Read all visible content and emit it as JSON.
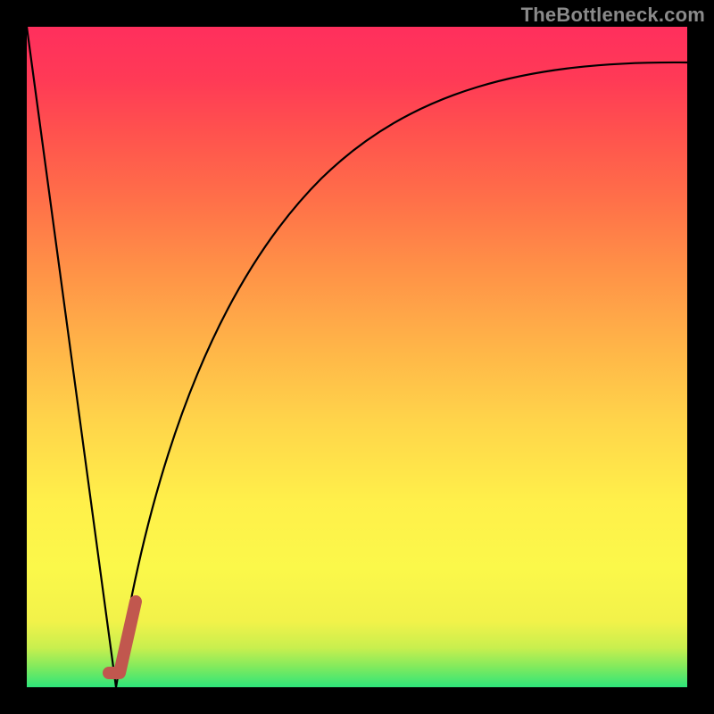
{
  "brand": {
    "label": "TheBottleneck.com"
  },
  "chart_data": {
    "type": "line",
    "title": "",
    "xlabel": "",
    "ylabel": "",
    "xlim": [
      0,
      100
    ],
    "ylim": [
      0,
      100
    ],
    "grid": false,
    "legend": false,
    "background_gradient": {
      "direction": "vertical",
      "stops": [
        {
          "pos": 0.0,
          "color": "#2ee57a"
        },
        {
          "pos": 0.1,
          "color": "#f2f24a"
        },
        {
          "pos": 0.5,
          "color": "#ffb04a"
        },
        {
          "pos": 1.0,
          "color": "#ff2f5d"
        }
      ]
    },
    "series": [
      {
        "name": "notch-left",
        "color": "#000000",
        "width": 2,
        "x": [
          0,
          2,
          4,
          6,
          8,
          10,
          12,
          13.5
        ],
        "y": [
          100,
          85.2,
          70.4,
          55.6,
          40.8,
          26.0,
          11.1,
          0.0
        ]
      },
      {
        "name": "curve-right",
        "color": "#000000",
        "width": 2,
        "x": [
          13.5,
          16,
          20,
          24,
          28,
          32,
          38,
          45,
          55,
          65,
          75,
          85,
          95,
          100
        ],
        "y": [
          0.0,
          14,
          32,
          46,
          56,
          63,
          72,
          79,
          85.5,
          89.5,
          92.0,
          93.5,
          94.3,
          94.6
        ]
      },
      {
        "name": "reference-marker",
        "color": "#c1574e",
        "width": 14,
        "linecap": "round",
        "x": [
          12.5,
          14.0,
          16.5
        ],
        "y": [
          2.0,
          2.0,
          13.0
        ]
      }
    ]
  }
}
